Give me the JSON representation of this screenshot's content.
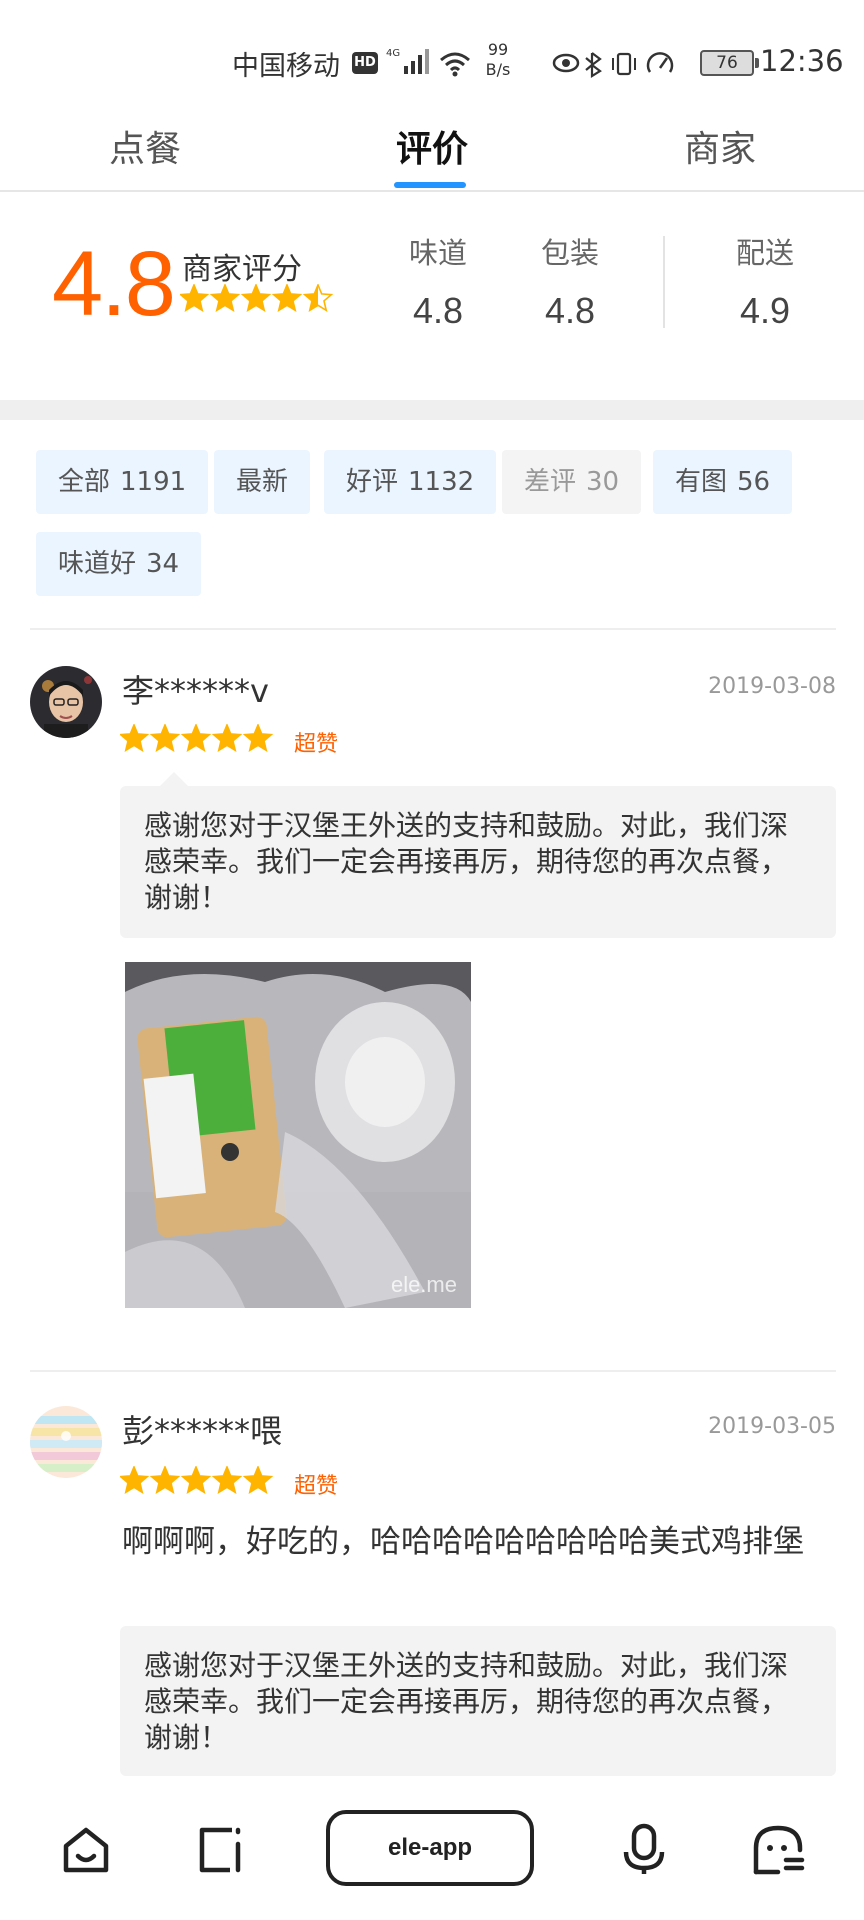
{
  "status_bar": {
    "carrier": "中国移动",
    "hd_badge": "HD",
    "network": "4G",
    "speed_value": "99",
    "speed_unit": "B/s",
    "battery": "76",
    "time": "12:36"
  },
  "tabs": [
    {
      "label": "点餐",
      "active": false
    },
    {
      "label": "评价",
      "active": true
    },
    {
      "label": "商家",
      "active": false
    }
  ],
  "rating": {
    "overall": "4.8",
    "overall_label": "商家评分",
    "overall_stars": 4.5,
    "metrics": [
      {
        "label": "味道",
        "value": "4.8"
      },
      {
        "label": "包装",
        "value": "4.8"
      },
      {
        "label": "配送",
        "value": "4.9"
      }
    ]
  },
  "filters": [
    {
      "label": "全部",
      "count": "1191",
      "enabled": true
    },
    {
      "label": "最新",
      "count": "",
      "enabled": true
    },
    {
      "label": "好评",
      "count": "1132",
      "enabled": true
    },
    {
      "label": "差评",
      "count": "30",
      "enabled": false
    },
    {
      "label": "有图",
      "count": "56",
      "enabled": true
    },
    {
      "label": "味道好",
      "count": "34",
      "enabled": true
    }
  ],
  "reviews": [
    {
      "user": "李******v",
      "date": "2019-03-08",
      "stars": 5,
      "badge": "超赞",
      "text": "",
      "reply": "感谢您对于汉堡王外送的支持和鼓励。对此，我们深感荣幸。我们一定会再接再厉，期待您的再次点餐，谢谢！",
      "photo_watermark": "ele.me"
    },
    {
      "user": "彭******喂",
      "date": "2019-03-05",
      "stars": 5,
      "badge": "超赞",
      "text": "啊啊啊，好吃的，哈哈哈哈哈哈哈哈哈美式鸡排堡",
      "reply": "感谢您对于汉堡王外送的支持和鼓励。对此，我们深感荣幸。我们一定会再接再厉，期待您的再次点餐，谢谢！"
    }
  ],
  "bottom_nav": {
    "pill_label": "ele-app",
    "icons": [
      "home-icon",
      "tabs-icon",
      "mic-icon",
      "assistant-icon"
    ]
  },
  "colors": {
    "accent_orange": "#ff6000",
    "star_yellow": "#ffb400",
    "tab_indicator": "#2395ff",
    "chip_bg": "#ebf5ff"
  }
}
